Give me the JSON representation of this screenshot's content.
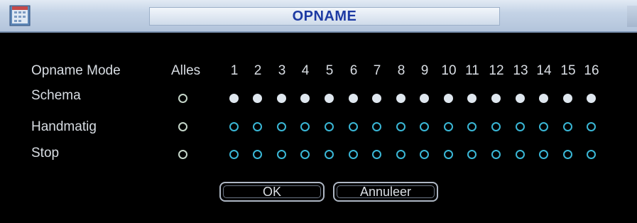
{
  "window": {
    "title": "OPNAME"
  },
  "icons": {
    "app_icon": "calendar-app-icon"
  },
  "header": {
    "mode_label": "Opname Mode",
    "all_label": "Alles",
    "channels": [
      "1",
      "2",
      "3",
      "4",
      "5",
      "6",
      "7",
      "8",
      "9",
      "10",
      "11",
      "12",
      "13",
      "14",
      "15",
      "16"
    ]
  },
  "rows": [
    {
      "label": "Schema",
      "all_selected": false,
      "channels_selected": [
        true,
        true,
        true,
        true,
        true,
        true,
        true,
        true,
        true,
        true,
        true,
        true,
        true,
        true,
        true,
        true
      ]
    },
    {
      "label": "Handmatig",
      "all_selected": false,
      "channels_selected": [
        false,
        false,
        false,
        false,
        false,
        false,
        false,
        false,
        false,
        false,
        false,
        false,
        false,
        false,
        false,
        false
      ]
    },
    {
      "label": "Stop",
      "all_selected": false,
      "channels_selected": [
        false,
        false,
        false,
        false,
        false,
        false,
        false,
        false,
        false,
        false,
        false,
        false,
        false,
        false,
        false,
        false
      ]
    }
  ],
  "buttons": {
    "ok_label": "OK",
    "cancel_label": "Annuleer"
  },
  "colors": {
    "title_text": "#1d3aa3",
    "radio_selected": "#dfe7ef",
    "radio_unselected_ring": "#3ab7d6",
    "text": "#d8dde3",
    "background": "#000000"
  }
}
